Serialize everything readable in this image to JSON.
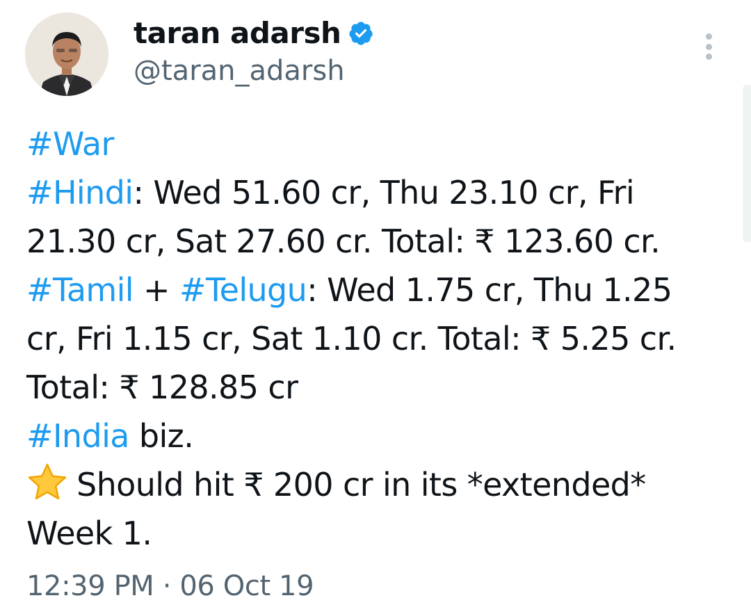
{
  "author": {
    "name": "taran adarsh",
    "handle": "@taran_adarsh",
    "verified_icon": "verified-badge-icon",
    "verified_color": "#1d9bf0"
  },
  "tweet": {
    "line1": {
      "tag": "#War"
    },
    "line2": {
      "tag": "#Hindi",
      "text": ": Wed 51.60 cr, Thu 23.10 cr, Fri"
    },
    "line3": {
      "text": "21.30 cr, Sat 27.60 cr. Total: ₹ 123.60 cr."
    },
    "line4": {
      "tag1": "#Tamil",
      "join": " + ",
      "tag2": "#Telugu",
      "text": ": Wed 1.75 cr, Thu 1.25"
    },
    "line5": {
      "text": "cr, Fri 1.15 cr, Sat 1.10 cr. Total: ₹ 5.25 cr."
    },
    "line6": {
      "text": "Total: ₹ 128.85 cr"
    },
    "line7": {
      "tag": "#India",
      "text": " biz."
    },
    "line8": {
      "icon": "star-emoji-icon",
      "text": "Should hit ₹ 200 cr in its *extended*"
    },
    "line9": {
      "text": "Week 1."
    }
  },
  "meta": {
    "timestamp": "12:39 PM · 06 Oct 19"
  },
  "colors": {
    "hashtag": "#1d9bf0",
    "secondary_text": "#536471",
    "primary_text": "#0f1419"
  }
}
